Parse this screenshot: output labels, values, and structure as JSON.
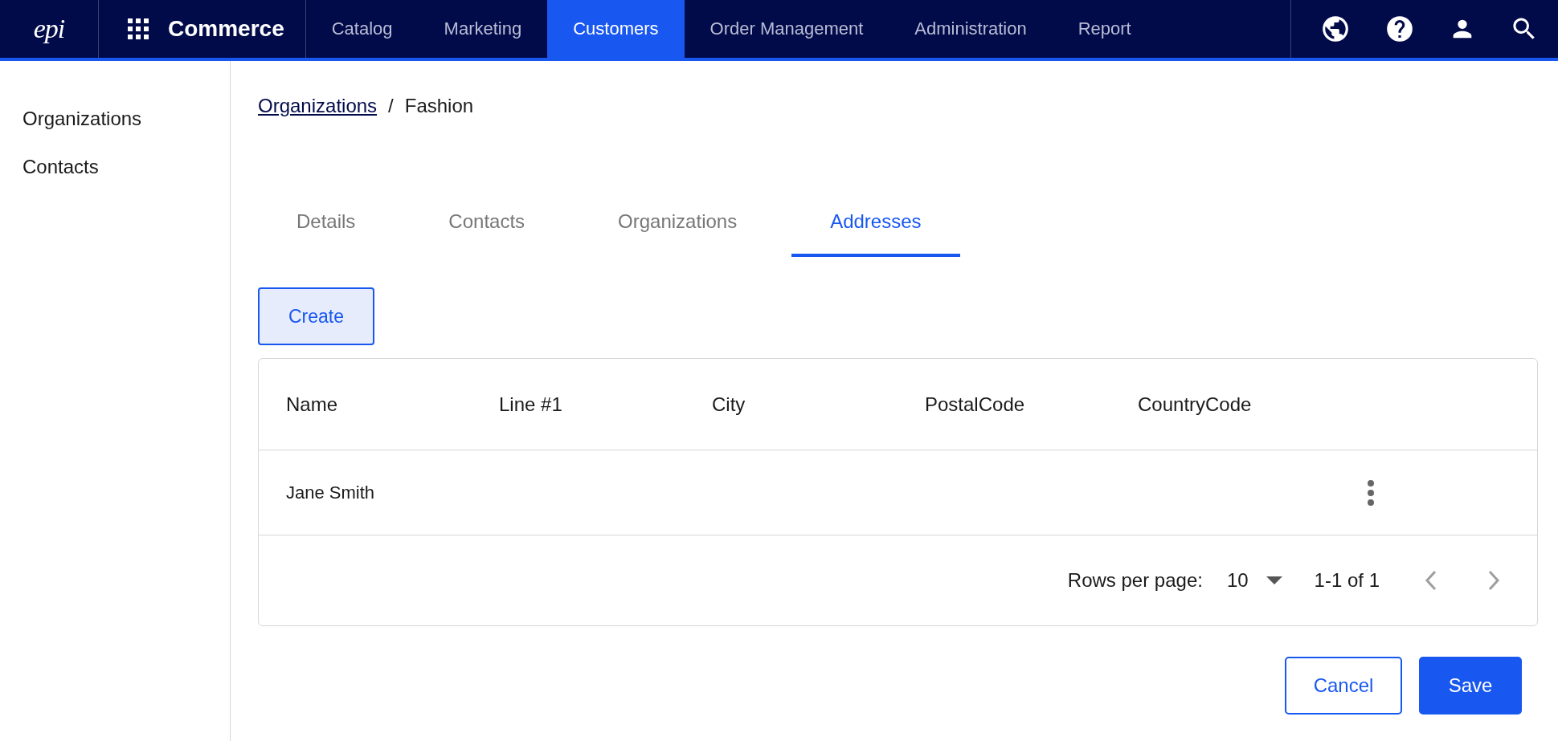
{
  "top_bar": {
    "logo": "epi",
    "app_title": "Commerce",
    "nav": [
      {
        "label": "Catalog",
        "selected": false
      },
      {
        "label": "Marketing",
        "selected": false
      },
      {
        "label": "Customers",
        "selected": true
      },
      {
        "label": "Order Management",
        "selected": false
      },
      {
        "label": "Administration",
        "selected": false
      },
      {
        "label": "Report",
        "selected": false
      }
    ]
  },
  "sidebar": {
    "items": [
      {
        "label": "Organizations"
      },
      {
        "label": "Contacts"
      }
    ]
  },
  "breadcrumb": {
    "link": "Organizations",
    "separator": "/",
    "current": "Fashion"
  },
  "tabs": [
    {
      "label": "Details",
      "selected": false
    },
    {
      "label": "Contacts",
      "selected": false
    },
    {
      "label": "Organizations",
      "selected": false
    },
    {
      "label": "Addresses",
      "selected": true
    }
  ],
  "create_button": "Create",
  "table": {
    "columns": [
      "Name",
      "Line #1",
      "City",
      "PostalCode",
      "CountryCode"
    ],
    "rows": [
      {
        "cells": [
          "Jane Smith",
          "",
          "",
          "",
          ""
        ]
      }
    ]
  },
  "pagination": {
    "rows_per_page_label": "Rows per page:",
    "rows_per_page": "10",
    "range": "1-1 of 1",
    "prev_disabled": true,
    "next_disabled": true
  },
  "buttons": {
    "cancel": "Cancel",
    "save": "Save"
  }
}
